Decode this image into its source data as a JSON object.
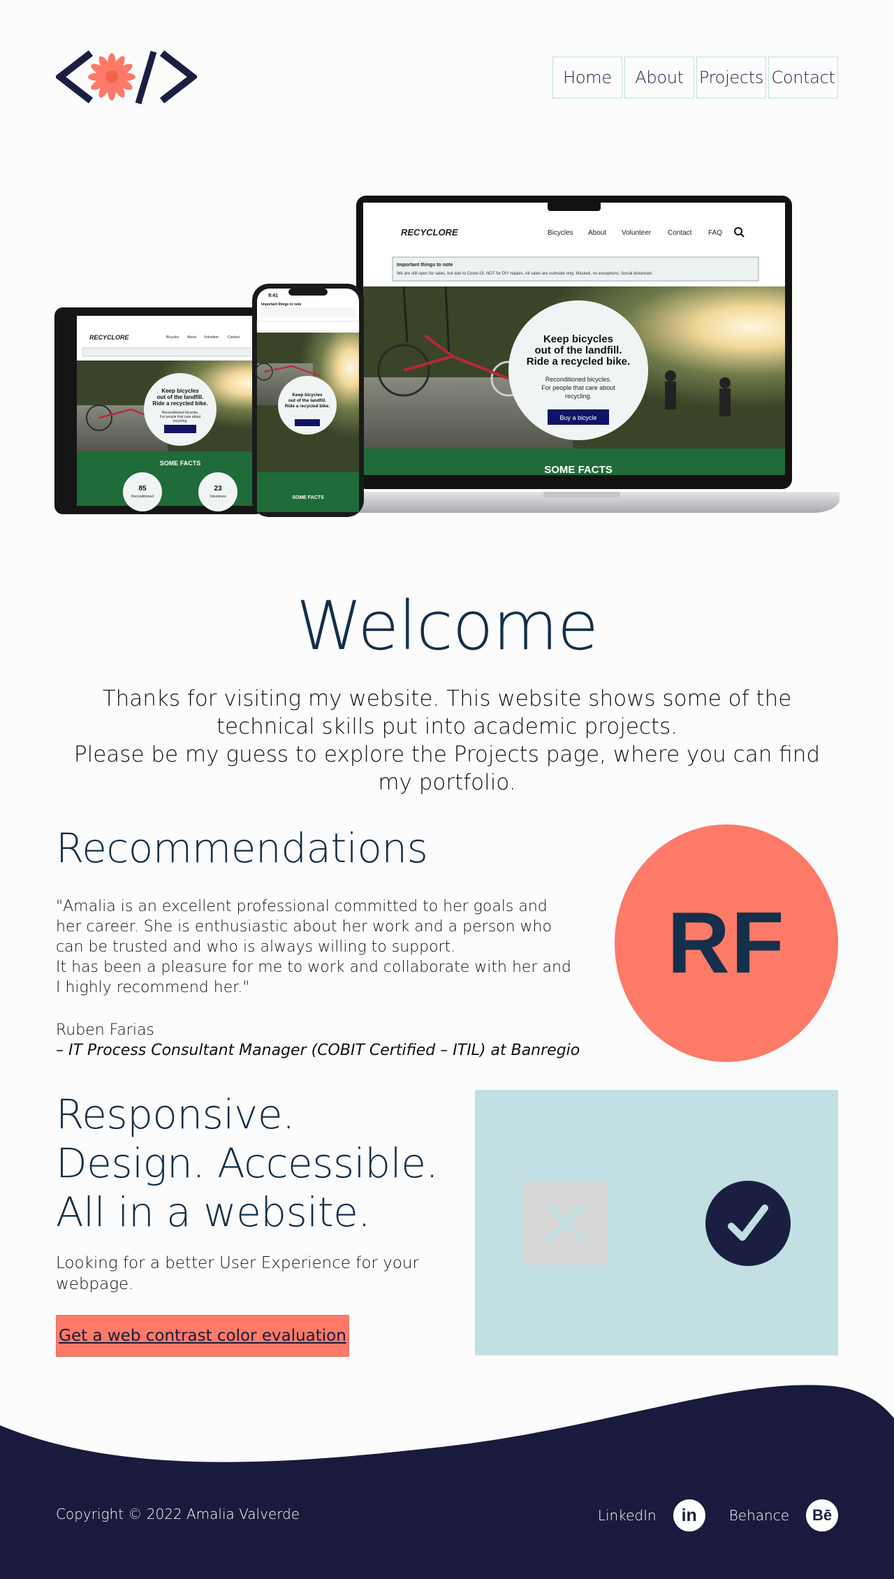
{
  "header": {
    "logo_alt": "Amalia Valverde logo",
    "nav": [
      "Home",
      "About",
      "Projects",
      "Contact"
    ]
  },
  "hero": {
    "laptop": {
      "brand": "RECYCLORE",
      "nav": [
        "Bicycles",
        "About",
        "Volunteer",
        "Contact",
        "FAQ"
      ],
      "notice_title": "Important things to note",
      "notice_text": "We are still open for sales, but due to Covid-19, NOT for DIY repairs. All sales are curbside only. Masked, no exceptions. Social distanced.",
      "headline": "Keep bicycles out of the landfill. Ride a recycled bike.",
      "subtext": "Reconditioned bicycles. For people that care about recycling.",
      "button": "Buy a bicycle",
      "facts": "SOME FACTS"
    },
    "tablet": {
      "facts": "SOME FACTS",
      "stat1_value": "85",
      "stat1_label": "Reconditioned bicycles",
      "stat2_value": "23",
      "stat2_label": "Volunteers"
    },
    "phone": {
      "time": "9:41",
      "facts": "SOME FACTS"
    }
  },
  "welcome": {
    "title": "Welcome",
    "line1": "Thanks for visiting my website. This website shows some of the technical skills put into academic projects.",
    "line2": "Please be my guess to explore the Projects page, where you can find my portfolio."
  },
  "recommendations": {
    "title": "Recommendations",
    "quote_1": "\"Amalia is an excellent professional committed to her goals and her career. She is enthusiastic about her work and a person who can be trusted and who is always willing to support.",
    "quote_2": "It has been a pleasure for me to work and collaborate with her and I highly recommend her.\"",
    "name": "Ruben Farias",
    "role": "– IT Process Consultant Manager (COBIT Certified – ITIL) at Banregio",
    "initials": "RF"
  },
  "responsive": {
    "title": "Responsive. Design. Accessible. All in a website.",
    "text": "Looking for a better User Experience for your webpage.",
    "cta": "Get a web contrast color evaluation"
  },
  "footer": {
    "copyright": "Copyright © 2022 Amalia Valverde",
    "linkedin_label": "LinkedIn",
    "linkedin_icon": "in",
    "behance_label": "Behance",
    "behance_icon": "Bē"
  },
  "colors": {
    "navy": "#1a1a3e",
    "teal_title": "#14304a",
    "coral": "#fd7a68",
    "light_blue": "#c2dfe3",
    "green_band": "#1f6b3a"
  }
}
